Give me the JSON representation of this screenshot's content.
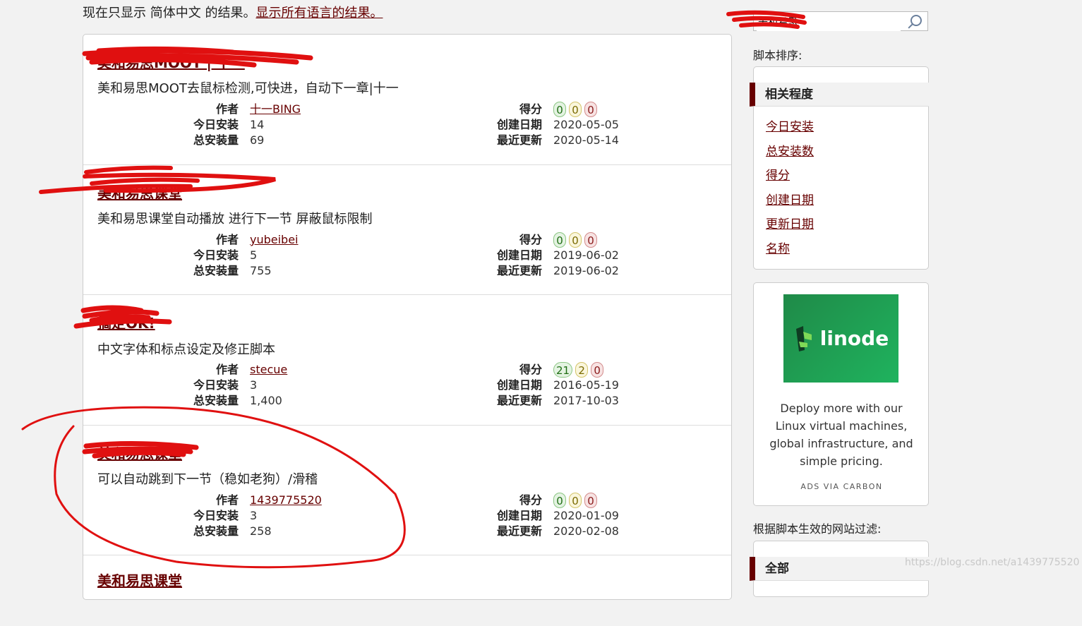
{
  "language_notice": {
    "text": "现在只显示 简体中文 的结果。",
    "link": "显示所有语言的结果。"
  },
  "scripts": [
    {
      "title": "美和易思MOOT | 十一",
      "description": "美和易思MOOT去鼠标检测,可快进，自动下一章|十一",
      "author": "十一BING",
      "daily_installs": "14",
      "total_installs": "69",
      "ratings": [
        "0",
        "0",
        "0"
      ],
      "created": "2020-05-05",
      "updated": "2020-05-14"
    },
    {
      "title": "美和易思课堂",
      "description": "美和易思课堂自动播放 进行下一节 屏蔽鼠标限制",
      "author": "yubeibei",
      "daily_installs": "5",
      "total_installs": "755",
      "ratings": [
        "0",
        "0",
        "0"
      ],
      "created": "2019-06-02",
      "updated": "2019-06-02"
    },
    {
      "title": "搞定OK!",
      "description": "中文字体和标点设定及修正脚本",
      "author": "stecue",
      "daily_installs": "3",
      "total_installs": "1,400",
      "ratings": [
        "21",
        "2",
        "0"
      ],
      "created": "2016-05-19",
      "updated": "2017-10-03"
    },
    {
      "title": "美和易思课堂",
      "description": "可以自动跳到下一节（稳如老狗）/滑稽",
      "author": "1439775520",
      "daily_installs": "3",
      "total_installs": "258",
      "ratings": [
        "0",
        "0",
        "0"
      ],
      "created": "2020-01-09",
      "updated": "2020-02-08"
    },
    {
      "title": "美和易思课堂"
    }
  ],
  "labels": {
    "author": "作者",
    "daily": "今日安装",
    "total": "总安装量",
    "score": "得分",
    "created": "创建日期",
    "updated": "最近更新"
  },
  "sidebar": {
    "search_value": "美和易思",
    "sort_label": "脚本排序:",
    "sort_active": "相关程度",
    "sort_options": [
      "今日安装",
      "总安装数",
      "得分",
      "创建日期",
      "更新日期",
      "名称"
    ],
    "ad": {
      "brand": "linode",
      "text": "Deploy more with our Linux virtual machines, global infrastructure, and simple pricing.",
      "via": "ADS VIA CARBON"
    },
    "filter_label": "根据脚本生效的网站过滤:",
    "filter_active": "全部"
  },
  "watermark": "https://blog.csdn.net/a1439775520",
  "colors": {
    "link": "#670000",
    "rating_good": "#1f6d13",
    "rating_ok": "#7a6a00",
    "rating_bad": "#8a1a1a",
    "ad_green": "#1fb35e",
    "scribble": "#e01010"
  }
}
